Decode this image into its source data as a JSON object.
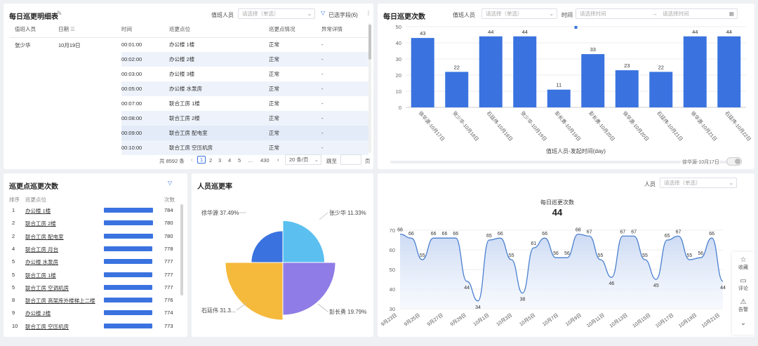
{
  "detail_table": {
    "title": "每日巡更明细表",
    "filter_label": "值班人员",
    "filter_placeholder": "请选择（单选）",
    "fields_button": "已选字段(6)",
    "columns": [
      "值班人员",
      "日期",
      "时间",
      "巡更点位",
      "巡更点情况",
      "异常详情"
    ],
    "person": "张少华",
    "date": "10月19日",
    "rows": [
      {
        "time": "00:01:00",
        "point": "办公楼 1楼",
        "status": "正常",
        "detail": "-"
      },
      {
        "time": "00:02:00",
        "point": "办公楼 2楼",
        "status": "正常",
        "detail": "-"
      },
      {
        "time": "00:03:00",
        "point": "办公楼 3楼",
        "status": "正常",
        "detail": "-"
      },
      {
        "time": "00:05:00",
        "point": "办公楼 水泵房",
        "status": "正常",
        "detail": "-"
      },
      {
        "time": "00:07:00",
        "point": "联合工房 1楼",
        "status": "正常",
        "detail": "-"
      },
      {
        "time": "00:08:00",
        "point": "联合工房 2楼",
        "status": "正常",
        "detail": "-"
      },
      {
        "time": "00:09:00",
        "point": "联合工房 配电室",
        "status": "正常",
        "detail": "-"
      },
      {
        "time": "00:10:00",
        "point": "联合工房 空压机房",
        "status": "正常",
        "detail": "-"
      }
    ],
    "pagination": {
      "total": "共 8592 条",
      "pages": [
        "1",
        "2",
        "3",
        "4",
        "5",
        "…",
        "430"
      ],
      "page_size": "20 条/页",
      "jump": "跳至",
      "page_unit": "页"
    }
  },
  "patrol_count": {
    "title": "每日巡更次数",
    "filter_label": "值班人员",
    "filter_placeholder": "请选择（单选）",
    "time_label": "时间",
    "start_placeholder": "请选择时间",
    "end_placeholder": "请选择时间",
    "slider_label": "徐华源-10月17日"
  },
  "point_rank": {
    "title": "巡更点巡更次数",
    "headers": [
      "排序",
      "巡更点位",
      "次数"
    ],
    "rows": [
      {
        "rank": "1",
        "name": "办公楼 1楼",
        "value": 784
      },
      {
        "rank": "2",
        "name": "联合工房 2楼",
        "value": 780
      },
      {
        "rank": "2",
        "name": "联合工房 配电室",
        "value": 780
      },
      {
        "rank": "4",
        "name": "联合工房 月台",
        "value": 778
      },
      {
        "rank": "5",
        "name": "办公楼 水泵房",
        "value": 777
      },
      {
        "rank": "5",
        "name": "联合工房 1楼",
        "value": 777
      },
      {
        "rank": "5",
        "name": "联合工房 空调机房",
        "value": 777
      },
      {
        "rank": "8",
        "name": "联合工房 高架库外楼梯上二楼",
        "value": 776
      },
      {
        "rank": "9",
        "name": "办公楼 2楼",
        "value": 774
      },
      {
        "rank": "10",
        "name": "联合工房 空压机房",
        "value": 773
      }
    ]
  },
  "person_rate": {
    "title": "人员巡更率"
  },
  "trend": {
    "person_label": "人员",
    "person_placeholder": "请选择（单选）",
    "tooltip_title": "每日巡更次数",
    "tooltip_value": "44"
  },
  "side_actions": [
    {
      "icon": "star-icon",
      "label": "收藏"
    },
    {
      "icon": "comment-icon",
      "label": "评论"
    },
    {
      "icon": "report-icon",
      "label": "告警"
    }
  ],
  "chart_data": [
    {
      "type": "bar",
      "title": "每日巡更次数",
      "xlabel": "值班人员-发起时间(day)",
      "ylabel": "",
      "ylim": [
        0,
        50
      ],
      "yticks": [
        0,
        10,
        20,
        30,
        40,
        50
      ],
      "categories": [
        "徐华源-10月17日",
        "张少华-10月18日",
        "石廷伟-10月18日",
        "张少华-10月19日",
        "彭长勇-10月19日",
        "彭长勇-10月20日",
        "徐华源-10月20日",
        "石廷伟-10月21日",
        "徐华源-10月21日",
        "石廷伟-10月22日"
      ],
      "values": [
        43,
        22,
        44,
        44,
        11,
        33,
        23,
        22,
        44,
        44
      ],
      "color": "#3a73e0"
    },
    {
      "type": "pie",
      "title": "人员巡更率",
      "labels": [
        "徐华源 37.49%",
        "张少华 11.33%",
        "彭长勇 19.79%",
        "石廷伟 31.3..."
      ],
      "values": [
        37.49,
        11.33,
        19.79,
        31.39
      ],
      "colors": [
        "#f5b93c",
        "#3a73e0",
        "#5bc0f0",
        "#8f7ce6"
      ]
    },
    {
      "type": "area",
      "title": "",
      "ylim": [
        30,
        70
      ],
      "yticks": [
        30,
        40,
        50,
        60,
        70
      ],
      "x": [
        "9月23日",
        "9月25日",
        "9月27日",
        "9月29日",
        "10月1日",
        "10月3日",
        "10月5日",
        "10月7日",
        "10月9日",
        "10月11日",
        "10月13日",
        "10月15日",
        "10月17日",
        "10月19日",
        "10月21日"
      ],
      "values": [
        68,
        66,
        55,
        66,
        66,
        66,
        44,
        34,
        65,
        66,
        55,
        38,
        61,
        66,
        56,
        56,
        68,
        67,
        55,
        46,
        67,
        67,
        55,
        45,
        65,
        67,
        55,
        56,
        66,
        44
      ],
      "color": "#4a7fcf"
    }
  ]
}
